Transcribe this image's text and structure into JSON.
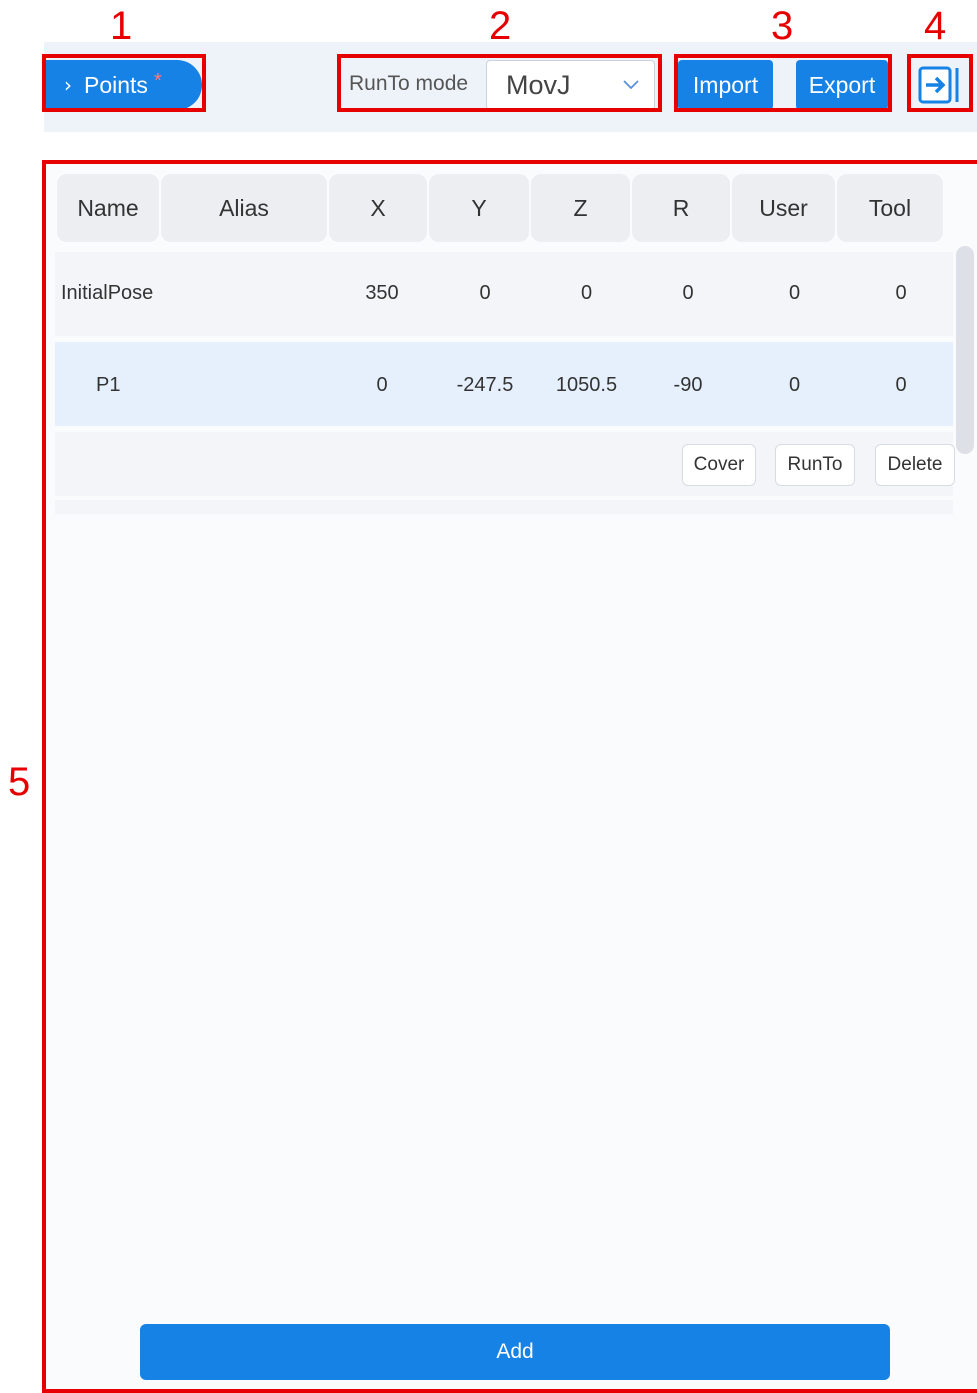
{
  "annotations": [
    "1",
    "2",
    "3",
    "4",
    "5"
  ],
  "toolbar": {
    "points_label": "Points",
    "points_marker": "*",
    "runto_label": "RunTo mode",
    "mode_value": "MovJ",
    "import_label": "Import",
    "export_label": "Export"
  },
  "table": {
    "headers": [
      "Name",
      "Alias",
      "X",
      "Y",
      "Z",
      "R",
      "User",
      "Tool"
    ],
    "rows": [
      {
        "name": "InitialPose",
        "alias": "",
        "x": "350",
        "y": "0",
        "z": "0",
        "r": "0",
        "user": "0",
        "tool": "0"
      },
      {
        "name": "P1",
        "alias": "",
        "x": "0",
        "y": "-247.5",
        "z": "1050.5",
        "r": "-90",
        "user": "0",
        "tool": "0"
      }
    ],
    "actions": {
      "cover": "Cover",
      "runto": "RunTo",
      "delete": "Delete"
    }
  },
  "add_label": "Add",
  "colors": {
    "accent": "#1782e6",
    "annotation": "#e60000",
    "selected_row": "#e6f0fc"
  }
}
